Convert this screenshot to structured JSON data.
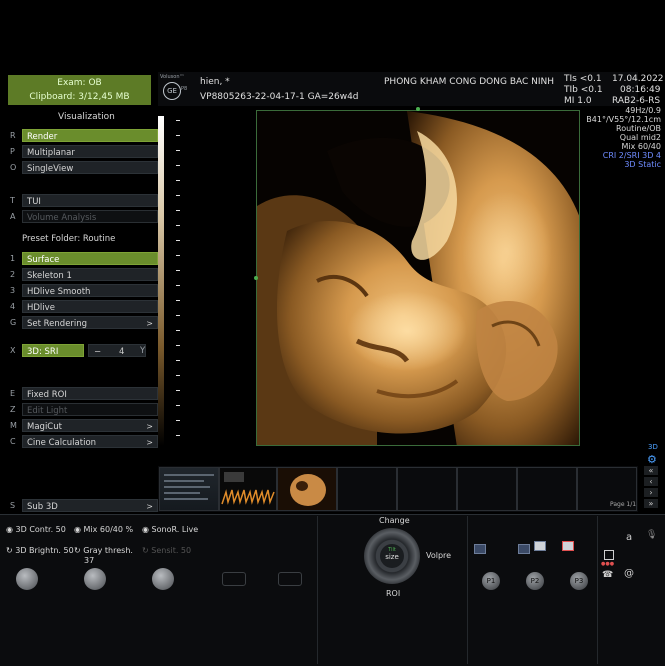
{
  "left_panel": {
    "exam_label": "Exam:  OB",
    "clipboard_label": "Clipboard:  3/12,45 MB",
    "visualization_title": "Visualization",
    "visualization_items": [
      {
        "key": "R",
        "label": "Render",
        "state": "active"
      },
      {
        "key": "P",
        "label": "Multiplanar",
        "state": "normal"
      },
      {
        "key": "O",
        "label": "SingleView",
        "state": "normal"
      }
    ],
    "tools_items": [
      {
        "key": "T",
        "label": "TUI",
        "state": "normal"
      },
      {
        "key": "A",
        "label": "Volume Analysis",
        "state": "disabled"
      }
    ],
    "preset_title": "Preset Folder: Routine",
    "preset_items": [
      {
        "key": "1",
        "label": "Surface",
        "state": "active"
      },
      {
        "key": "2",
        "label": "Skeleton 1",
        "state": "normal"
      },
      {
        "key": "3",
        "label": "HDlive Smooth",
        "state": "normal"
      },
      {
        "key": "4",
        "label": "HDlive",
        "state": "normal"
      },
      {
        "key": "G",
        "label": "Set Rendering",
        "state": "normal",
        "arrow": ">"
      }
    ],
    "sri": {
      "key": "X",
      "label": "3D: SRI",
      "minus": "−",
      "value": "4",
      "axis": "Y"
    },
    "roi_items": [
      {
        "key": "E",
        "label": "Fixed ROI",
        "state": "normal"
      },
      {
        "key": "Z",
        "label": "Edit Light",
        "state": "disabled"
      },
      {
        "key": "M",
        "label": "MagiCut",
        "state": "normal",
        "arrow": ">"
      },
      {
        "key": "C",
        "label": "Cine Calculation",
        "state": "normal",
        "arrow": ">"
      }
    ],
    "sub3d": {
      "key": "S",
      "label": "Sub 3D",
      "arrow": ">"
    }
  },
  "header": {
    "logo_top": "Voluson™",
    "logo_badge": "GE",
    "logo_right": "P8",
    "patient_name": "hien,  *",
    "patient_id": "VP8805263-22-04-17-1  GA=26w4d",
    "clinic": "PHONG KHAM CONG DONG BAC NINH",
    "tis": "TIs <0.1",
    "tib": "TIb <0.1",
    "mi": "MI  1.0",
    "date": "17.04.2022",
    "time": "08:16:49",
    "probe": "RAB2-6-RS"
  },
  "right_params": {
    "lines": [
      "49Hz/0.9",
      "B41°/V55°/12.1cm",
      "Routine/OB",
      "Qual mid2",
      "Mix 60/40"
    ],
    "blue_lines": [
      "CRI 2/SRI 3D 4",
      "3D Static"
    ],
    "corner_label": "3D"
  },
  "thumbnails": {
    "page_label": "Page 1/1"
  },
  "bottom": {
    "controls_row1": [
      {
        "label": "3D Contr. 50"
      },
      {
        "label": "Mix 60/40 %"
      },
      {
        "label": "SonoR. Live"
      }
    ],
    "controls_row2": [
      {
        "label": "3D Brightn. 50"
      },
      {
        "label": "Gray thresh."
      },
      {
        "label": "Sensit. 50"
      }
    ],
    "gray_thresh_value": "37",
    "change_label": "Change",
    "center_top": "Tilt",
    "center_label": "size",
    "volpre_label": "Volpre",
    "roi_label": "ROI",
    "p_buttons": [
      "P1",
      "P2",
      "P3"
    ],
    "corner_letter": "a"
  }
}
